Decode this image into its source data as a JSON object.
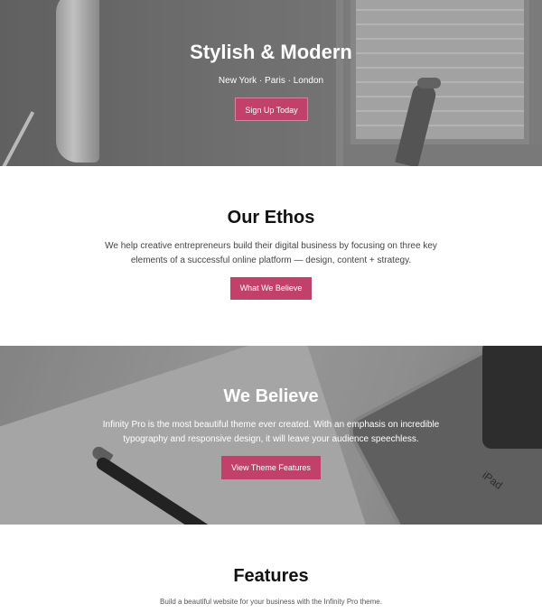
{
  "hero": {
    "title": "Stylish & Modern",
    "subtitle": "New York · Paris · London",
    "button_label": "Sign Up Today"
  },
  "ethos": {
    "title": "Our Ethos",
    "text": "We help creative entrepreneurs build their digital business by focusing on three key elements of a successful online platform — design, content + strategy.",
    "button_label": "What We Believe"
  },
  "believe": {
    "title": "We Believe",
    "text": "Infinity Pro is the most beautiful theme ever created. With an emphasis on incredible typography and responsive design, it will leave your audience speechless.",
    "button_label": "View Theme Features",
    "image_text": "iPad"
  },
  "features": {
    "title": "Features",
    "text": "Build a beautiful website for your business with the Infinity Pro theme."
  },
  "colors": {
    "accent": "#c2416b",
    "hero_bg": "#7a7a7a",
    "text_dark": "#111111"
  }
}
